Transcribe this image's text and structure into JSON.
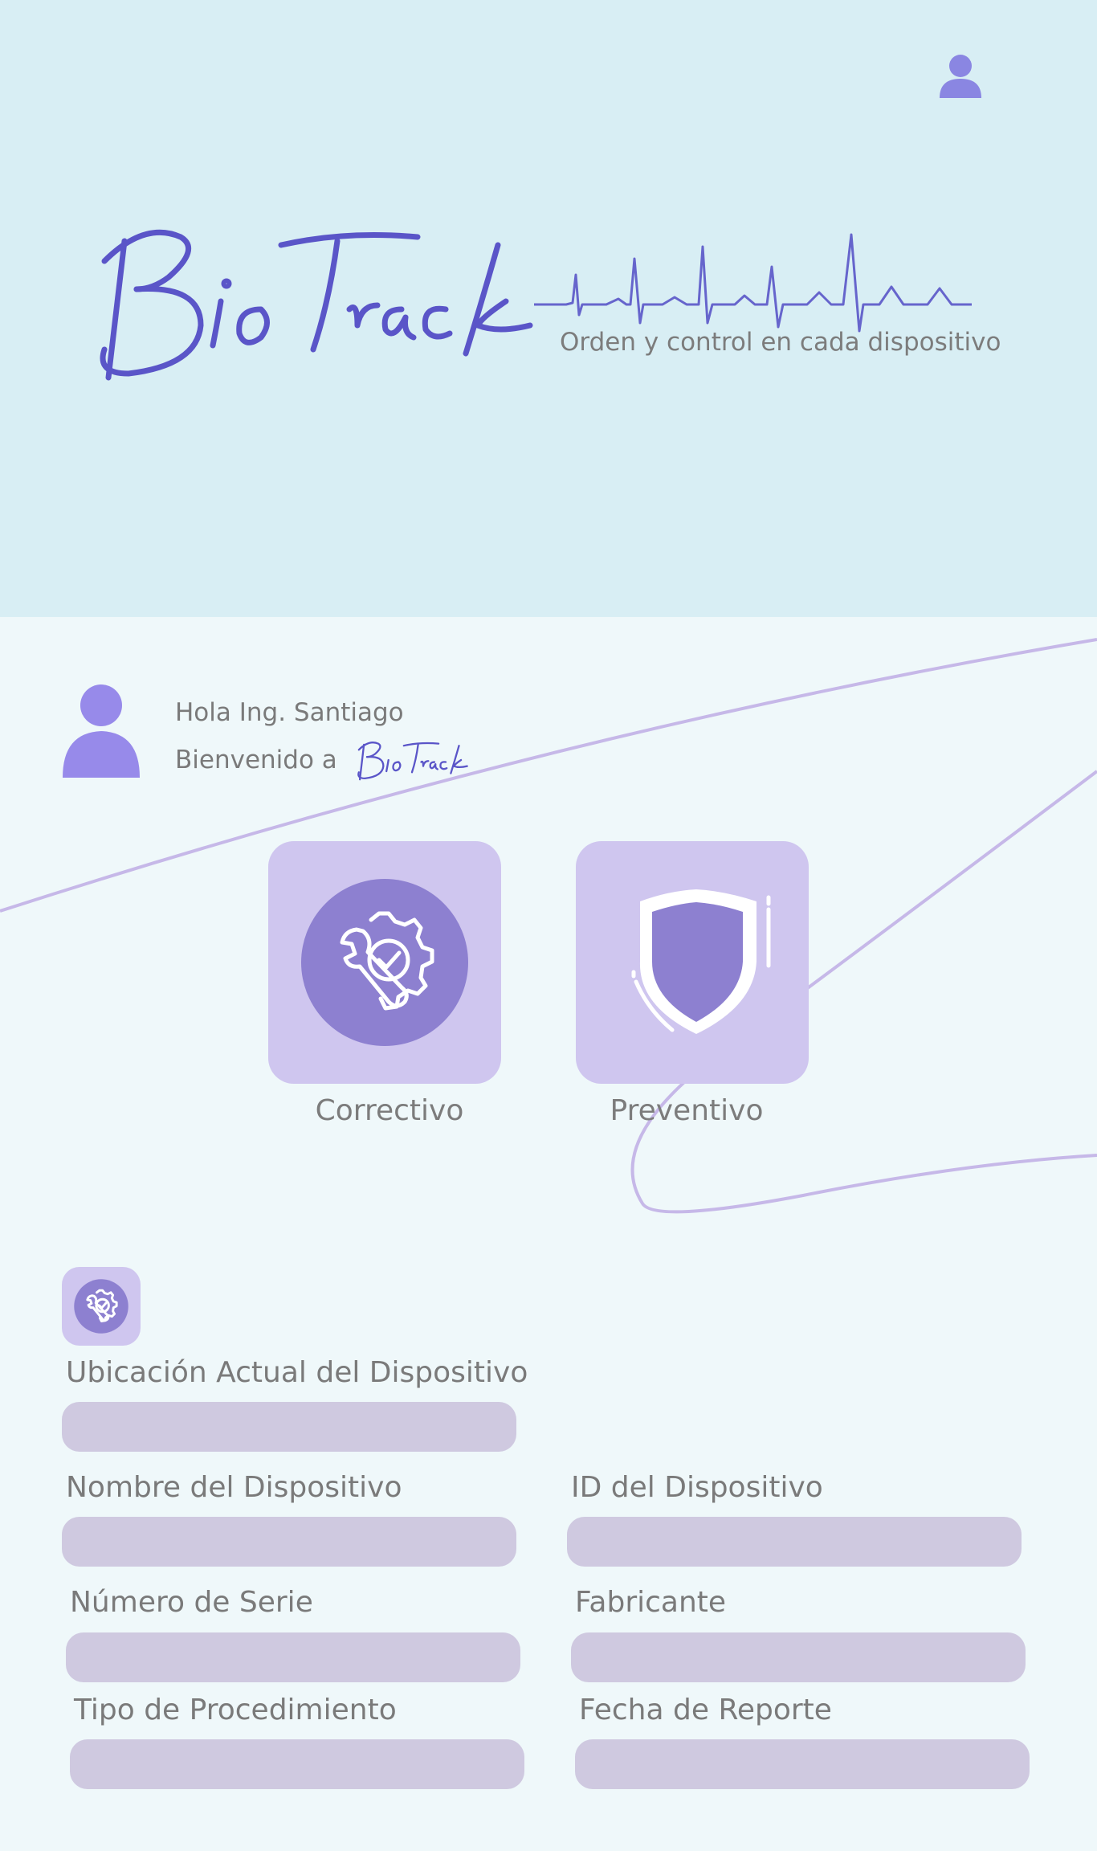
{
  "header": {
    "brand": "BioTrack",
    "tagline": "Orden y control en cada dispositivo"
  },
  "greeting": {
    "hello": "Hola Ing. Santiago",
    "welcome_prefix": "Bienvenido a",
    "brand": "BioTrack"
  },
  "maintenance": {
    "corrective_label": "Correctivo",
    "preventive_label": "Preventivo"
  },
  "form": {
    "location_label": "Ubicación Actual del Dispositivo",
    "location_value": "",
    "device_name_label": "Nombre del Dispositivo",
    "device_name_value": "",
    "device_id_label": "ID del Dispositivo",
    "device_id_value": "",
    "serial_label": "Número de Serie",
    "serial_value": "",
    "manufacturer_label": "Fabricante",
    "manufacturer_value": "",
    "procedure_label": "Tipo de Procedimiento",
    "procedure_value": "",
    "report_date_label": "Fecha de Reporte",
    "report_date_value": ""
  },
  "colors": {
    "hero_bg": "#d8eef4",
    "page_bg": "#eff8fa",
    "brand_blue": "#5a55c8",
    "accent_purple": "#8d80d0",
    "card_bg": "#cfc6ef",
    "field_bg": "#cfc9e0"
  },
  "icons": [
    "user-profile-icon",
    "user-avatar-icon",
    "gear-wrench-check-icon",
    "shield-icon"
  ]
}
